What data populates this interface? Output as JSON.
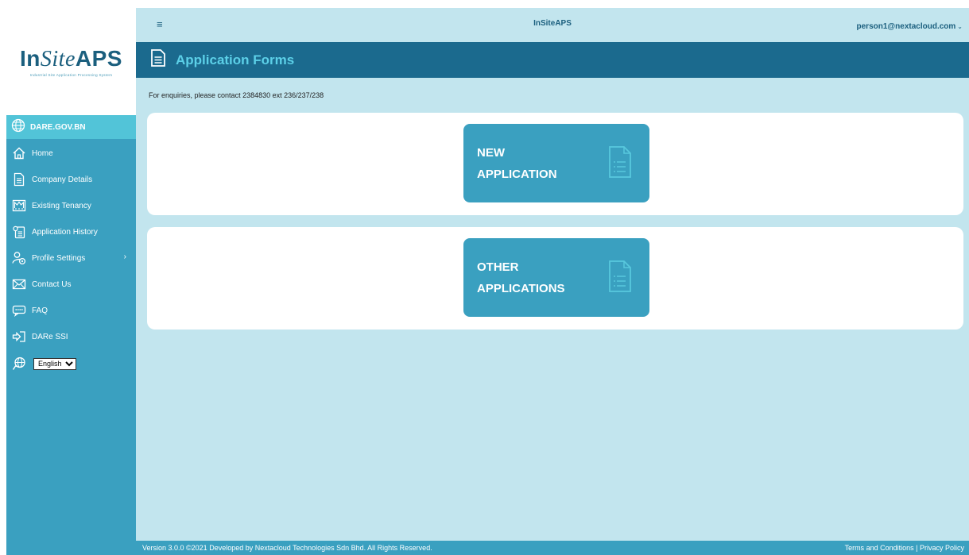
{
  "brand": {
    "logo_prefix": "In",
    "logo_middle": "Site",
    "logo_suffix": "APS",
    "logo_subtitle": "Industrial Site Application Processing System"
  },
  "topbar": {
    "menu_icon": "hamburger-icon",
    "title": "InSiteAPS",
    "user_email": "person1@nextacloud.com"
  },
  "sidebar": {
    "site": {
      "label": "DARE.GOV.BN",
      "icon": "globe-icon"
    },
    "items": [
      {
        "label": "Home",
        "icon": "home-icon"
      },
      {
        "label": "Company Details",
        "icon": "document-icon"
      },
      {
        "label": "Existing Tenancy",
        "icon": "factory-icon"
      },
      {
        "label": "Application History",
        "icon": "clipboard-icon"
      },
      {
        "label": "Profile Settings",
        "icon": "user-settings-icon"
      },
      {
        "label": "Contact Us",
        "icon": "envelope-icon"
      },
      {
        "label": "FAQ",
        "icon": "chat-icon"
      },
      {
        "label": "DARe SSI",
        "icon": "login-arrow-icon"
      }
    ],
    "language": {
      "selected": "English",
      "icon": "globe-hand-icon"
    }
  },
  "page": {
    "title": "Application Forms",
    "enquiry": "For enquiries, please contact 2384830 ext 236/237/238"
  },
  "buttons": {
    "new_application": {
      "line1": "NEW",
      "line2": "APPLICATION"
    },
    "other_applications": {
      "line1": "OTHER",
      "line2": "APPLICATIONS"
    }
  },
  "footer": {
    "copyright": "Version 3.0.0 ©2021 Developed by Nextacloud Technologies Sdn Bhd. All Rights Reserved.",
    "terms": "Terms and Conditions",
    "separator": "|",
    "privacy": "Privacy Policy"
  },
  "colors": {
    "sidebar": "#3aa0c0",
    "header_dark": "#1b6a8e",
    "header_title": "#5cd0e8",
    "background": "#c2e5ee",
    "site_highlight": "#52c4d8"
  }
}
